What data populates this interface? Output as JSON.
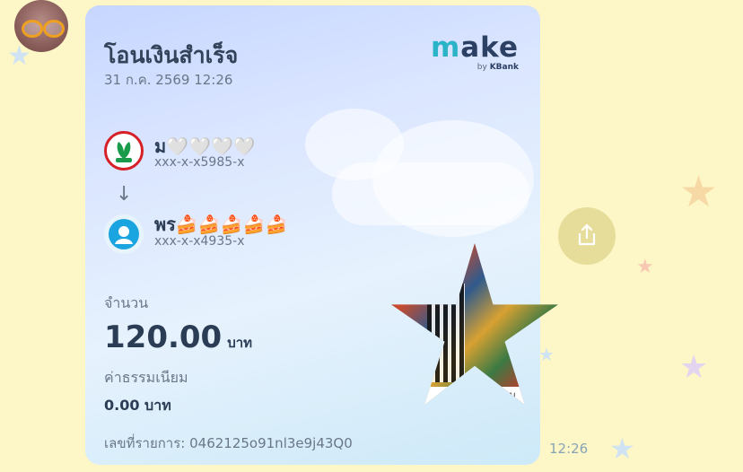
{
  "chat": {
    "timestamp": "12:26",
    "share_icon": "share-icon"
  },
  "slip": {
    "title": "โอนเงินสำเร็จ",
    "datetime": "31 ก.ค. 2569 12:26",
    "logo": {
      "word": "make",
      "sub_by": "by",
      "sub_brand": "KBank"
    },
    "sender": {
      "bank_icon": "kbank-icon",
      "name": "ม🤍🤍🤍🤍",
      "account": "xxx-x-x5985-x"
    },
    "receiver": {
      "bank_icon": "ktb-icon",
      "name": "พร🍰🍰🍰🍰🍰",
      "account": "xxx-x-x4935-x"
    },
    "amount_label": "จำนวน",
    "amount": "120.00",
    "currency": "บาท",
    "fee_label": "ค่าธรรมเนียม",
    "fee": "0.00 บาท",
    "reference": "เลขที่รายการ: 0462125o91nl3e9j43Q0",
    "qr_caption": "แกนเพื่อตรวจสอบ"
  },
  "colors": {
    "background": "#fdf6c6",
    "accent": "#2bb3c7",
    "kbank_red": "#d61f26",
    "text_dark": "#2b3c55"
  }
}
